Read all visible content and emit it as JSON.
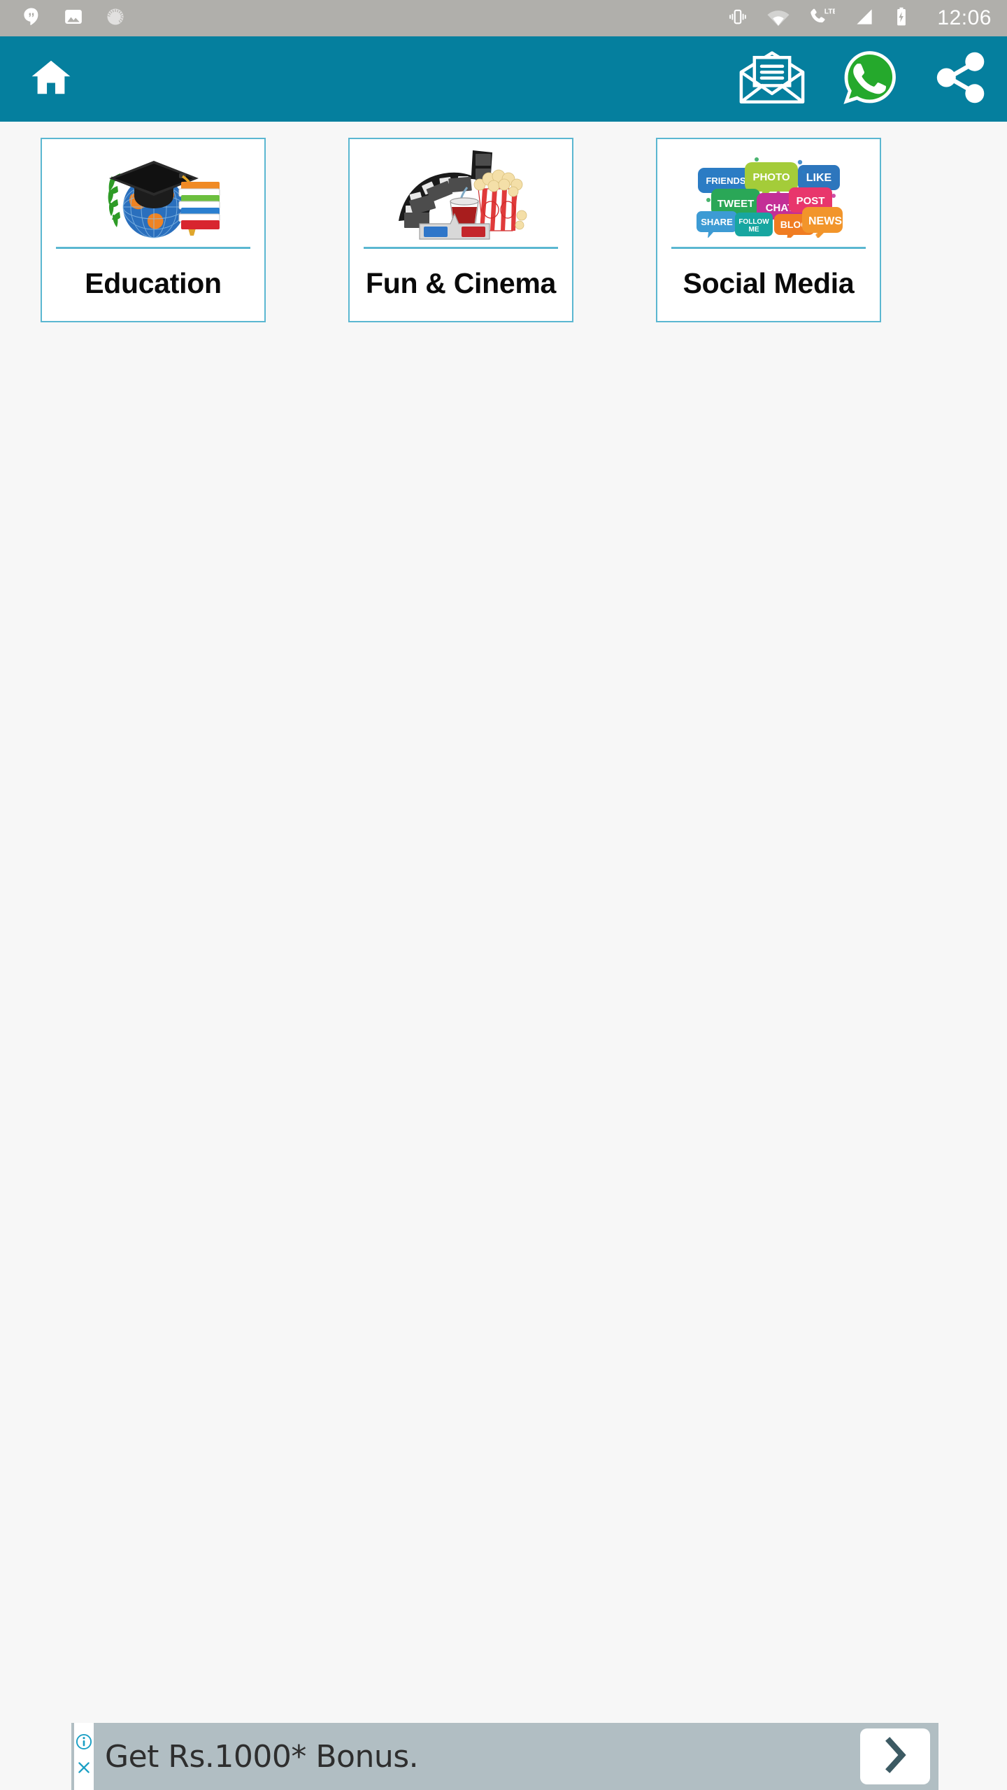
{
  "status_bar": {
    "background_color": "#b0afab",
    "time": "12:06",
    "left_icons": [
      {
        "name": "hangouts-icon",
        "label": "Hangouts"
      },
      {
        "name": "photo-icon",
        "label": "Image"
      },
      {
        "name": "sync-spinner-icon",
        "label": "Sync"
      }
    ],
    "right_icons": [
      {
        "name": "vibrate-icon",
        "label": "Vibrate"
      },
      {
        "name": "wifi-icon",
        "label": "Wi-Fi"
      },
      {
        "name": "lte-call-icon",
        "label": "LTE"
      },
      {
        "name": "cell-signal-icon",
        "label": "Signal"
      },
      {
        "name": "battery-charging-icon",
        "label": "Charging"
      }
    ],
    "lte_label": "LTE"
  },
  "app_bar": {
    "background_color": "#057f9e",
    "home_icon": "home-icon",
    "actions": [
      {
        "name": "mail-icon",
        "label": "Mail"
      },
      {
        "name": "whatsapp-icon",
        "label": "WhatsApp",
        "color": "#25a92c"
      },
      {
        "name": "share-icon",
        "label": "Share"
      }
    ]
  },
  "theme": {
    "accent": "#057f9e",
    "card_border": "#5bb7d1",
    "page_background": "#f7f7f7",
    "card_background": "#ffffff"
  },
  "cards": [
    {
      "id": "education",
      "label": "Education",
      "icon": "graduation-globe-books-icon"
    },
    {
      "id": "fun-cinema",
      "label": "Fun & Cinema",
      "icon": "filmstrip-popcorn-icon"
    },
    {
      "id": "social-media",
      "label": "Social Media",
      "icon": "speech-bubbles-icon"
    }
  ],
  "social_bubbles": [
    {
      "text": "FRIENDS",
      "color": "#2b7cc4"
    },
    {
      "text": "PHOTO",
      "color": "#a4cc39"
    },
    {
      "text": "LIKE",
      "color": "#2d76bd"
    },
    {
      "text": "TWEET",
      "color": "#2aa757"
    },
    {
      "text": "CHAT",
      "color": "#c32f96"
    },
    {
      "text": "POST",
      "color": "#e8366c"
    },
    {
      "text": "SHARE",
      "color": "#3d9bd4"
    },
    {
      "text": "FOLLOW ME",
      "color": "#17a6a0"
    },
    {
      "text": "BLOG",
      "color": "#f07c22"
    },
    {
      "text": "NEWS",
      "color": "#f2952b"
    }
  ],
  "ad": {
    "text": "Get Rs.1000* Bonus.",
    "background_color": "#b1bec3",
    "info_icon": "info-icon",
    "close_icon": "close-icon",
    "cta_icon": "chevron-right-icon"
  }
}
